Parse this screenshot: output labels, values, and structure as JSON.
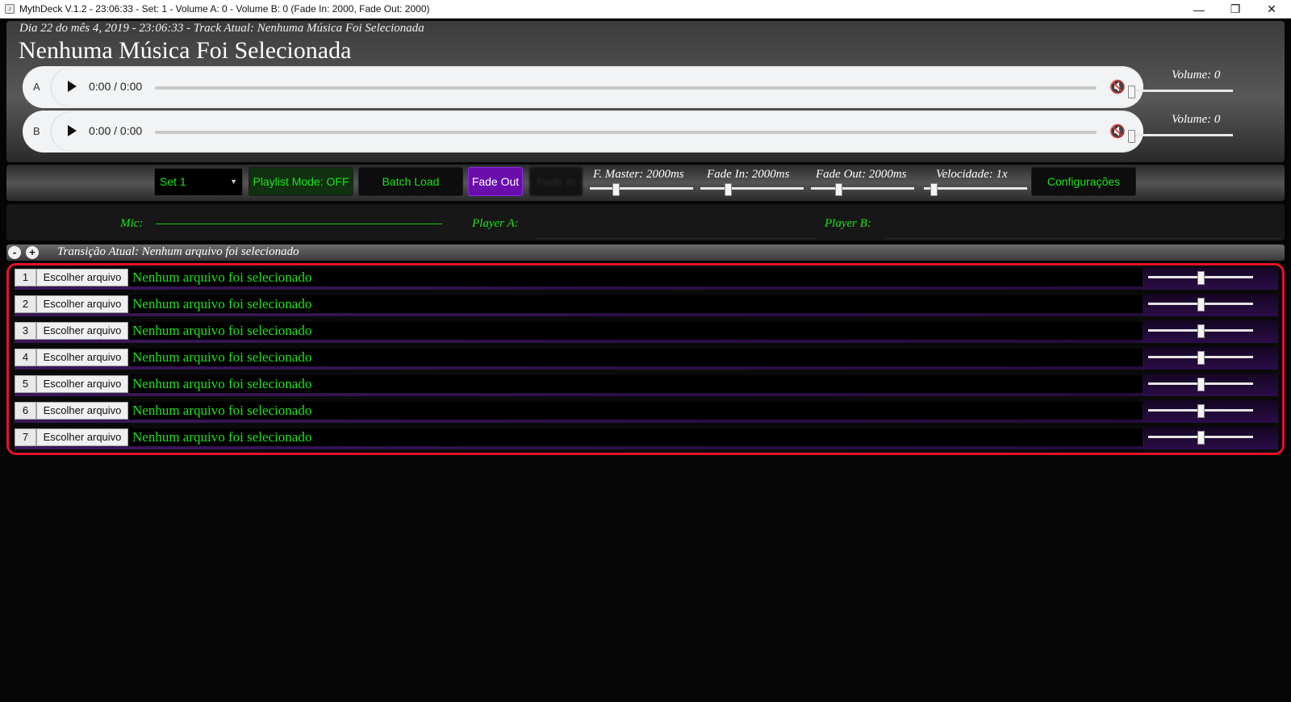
{
  "window": {
    "title": "MythDeck V.1.2 - 23:06:33 - Set: 1 - Volume A: 0 - Volume B: 0 (Fade In: 2000, Fade Out: 2000)",
    "minimize": "—",
    "maximize": "❐",
    "close": "✕"
  },
  "header": {
    "subtitle": "Dia 22 do mês 4, 2019 - 23:06:33 - Track Atual: Nenhuma Música Foi Selecionada",
    "title": "Nenhuma Música Foi Selecionada"
  },
  "players": [
    {
      "label": "A",
      "time": "0:00 / 0:00",
      "volume_label": "Volume: 0",
      "volume": 0
    },
    {
      "label": "B",
      "time": "0:00 / 0:00",
      "volume_label": "Volume: 0",
      "volume": 0
    }
  ],
  "toolbar": {
    "set_select": "Set 1",
    "playlist_mode": "Playlist Mode: OFF",
    "batch_load": "Batch Load",
    "fade_out": "Fade Out",
    "fade_in": "Fade In",
    "f_master": "F. Master: 2000ms",
    "fade_in_label": "Fade In: 2000ms",
    "fade_out_label": "Fade Out: 2000ms",
    "velocidade": "Velocidade: 1x",
    "configuracoes": "Configurações"
  },
  "meters": {
    "mic": "Mic:",
    "player_a": "Player A:",
    "player_b": "Player B:"
  },
  "transition": {
    "minus": "-",
    "plus": "+",
    "text": "Transição Atual: Nenhum arquivo foi selecionado"
  },
  "tracks": [
    {
      "num": "1",
      "button": "Escolher arquivo",
      "name": "Nenhum arquivo foi selecionado"
    },
    {
      "num": "2",
      "button": "Escolher arquivo",
      "name": "Nenhum arquivo foi selecionado"
    },
    {
      "num": "3",
      "button": "Escolher arquivo",
      "name": "Nenhum arquivo foi selecionado"
    },
    {
      "num": "4",
      "button": "Escolher arquivo",
      "name": "Nenhum arquivo foi selecionado"
    },
    {
      "num": "5",
      "button": "Escolher arquivo",
      "name": "Nenhum arquivo foi selecionado"
    },
    {
      "num": "6",
      "button": "Escolher arquivo",
      "name": "Nenhum arquivo foi selecionado"
    },
    {
      "num": "7",
      "button": "Escolher arquivo",
      "name": "Nenhum arquivo foi selecionado"
    }
  ],
  "colors": {
    "accent_green": "#19e619",
    "accent_purple": "#6a0dab",
    "highlight_red": "#e5112a"
  }
}
